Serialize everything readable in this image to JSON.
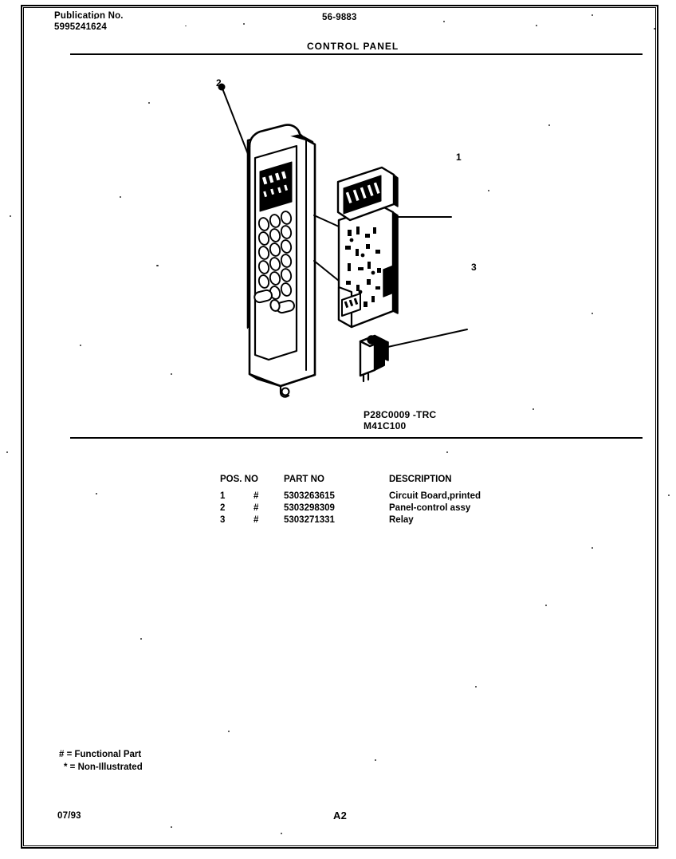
{
  "header": {
    "publication_label": "Publication No.",
    "publication_number": "5995241624",
    "model_number": "56-9883",
    "sheet_title": "CONTROL PANEL"
  },
  "figure": {
    "codes": {
      "line_1": "P28C0009 -TRC",
      "line_2": "M41C100"
    },
    "callouts": [
      {
        "id": "1",
        "label": "1",
        "target": "circuit-board"
      },
      {
        "id": "2",
        "label": "2",
        "target": "panel-control-assembly"
      },
      {
        "id": "3",
        "label": "3",
        "target": "relay"
      }
    ]
  },
  "parts_table": {
    "headers": {
      "pos_no": "POS. NO",
      "part_no": "PART NO",
      "description": "DESCRIPTION"
    },
    "rows": [
      {
        "pos_no": "1",
        "flag": "#",
        "part_no": "5303263615",
        "description": "Circuit Board,printed"
      },
      {
        "pos_no": "2",
        "flag": "#",
        "part_no": "5303298309",
        "description": "Panel-control assy"
      },
      {
        "pos_no": "3",
        "flag": "#",
        "part_no": "5303271331",
        "description": "Relay"
      }
    ]
  },
  "legend": {
    "functional": "# = Functional Part",
    "non_illustrated": "* = Non-Illustrated"
  },
  "footer": {
    "date": "07/93",
    "page": "A2"
  }
}
